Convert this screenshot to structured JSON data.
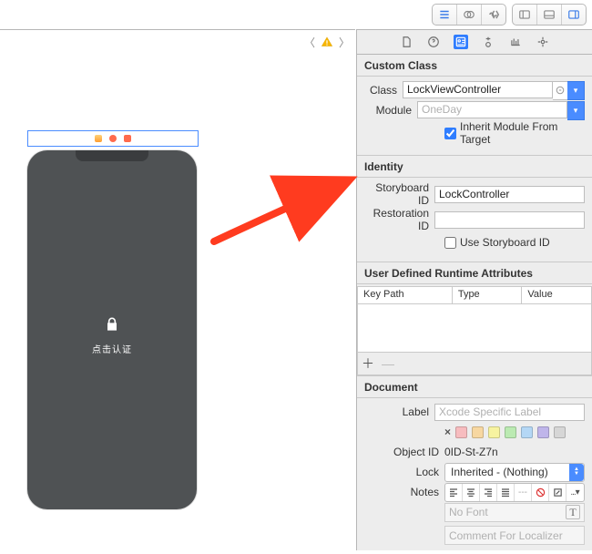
{
  "custom_class": {
    "section_title": "Custom Class",
    "class_label": "Class",
    "class_value": "LockViewController",
    "module_label": "Module",
    "module_placeholder": "OneDay",
    "inherit_label": "Inherit Module From Target",
    "inherit_checked": true
  },
  "identity": {
    "section_title": "Identity",
    "storyboard_id_label": "Storyboard ID",
    "storyboard_id_value": "LockController",
    "restoration_id_label": "Restoration ID",
    "restoration_id_value": "",
    "use_storyboard_id_label": "Use Storyboard ID",
    "use_storyboard_id_checked": false
  },
  "runtime_attrs": {
    "section_title": "User Defined Runtime Attributes",
    "cols": {
      "keypath": "Key Path",
      "type": "Type",
      "value": "Value"
    }
  },
  "document": {
    "section_title": "Document",
    "label_label": "Label",
    "label_placeholder": "Xcode Specific Label",
    "object_id_label": "Object ID",
    "object_id_value": "0ID-St-Z7n",
    "lock_label": "Lock",
    "lock_value": "Inherited - (Nothing)",
    "notes_label": "Notes",
    "font_placeholder": "No Font",
    "localizer_placeholder": "Comment For Localizer",
    "swatches": [
      "#f7bcbf",
      "#f7d7a1",
      "#f7f3a0",
      "#bbeab2",
      "#b4d7f5",
      "#bfb5ea",
      "#d6d6d6"
    ]
  },
  "phone": {
    "caption": "点击认证"
  }
}
